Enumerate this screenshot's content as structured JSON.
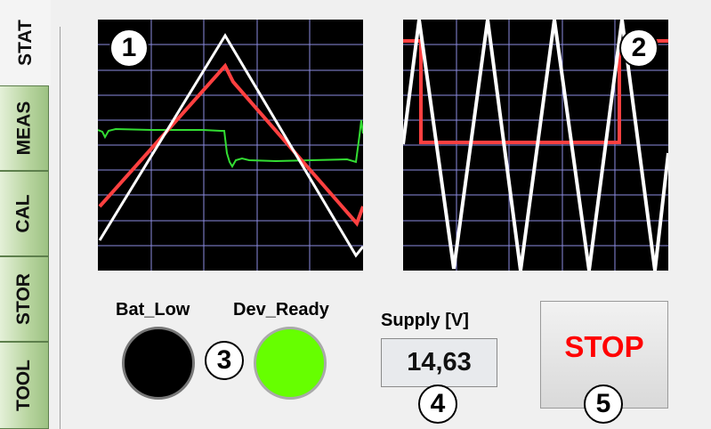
{
  "tabs": [
    {
      "label": "STAT",
      "active": true
    },
    {
      "label": "MEAS",
      "active": false
    },
    {
      "label": "CAL",
      "active": false
    },
    {
      "label": "STOR",
      "active": false
    },
    {
      "label": "TOOL",
      "active": false
    }
  ],
  "markers": [
    "1",
    "2",
    "3",
    "4",
    "5"
  ],
  "indicators": [
    {
      "label": "Bat_Low",
      "color": "#000000"
    },
    {
      "label": "Dev_Ready",
      "color": "#66ff00"
    }
  ],
  "supply": {
    "label": "Supply [V]",
    "value": "14,63"
  },
  "stop_button": {
    "label": "STOP",
    "color": "#ff0000"
  },
  "scope_colors": {
    "background": "#000000",
    "grid": "#8c8ce0",
    "white_trace": "#ffffff",
    "red_trace": "#ff4040",
    "green_trace": "#33dd33"
  }
}
